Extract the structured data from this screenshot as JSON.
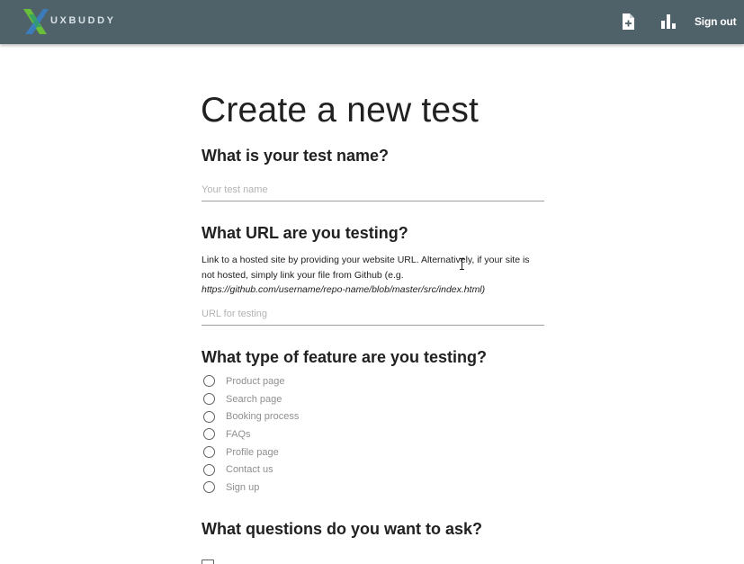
{
  "brand": {
    "name": "UXBUDDY",
    "colors": {
      "topbar": "#4f6169",
      "logo_green": "#6abf3a",
      "logo_blue": "#3a7fc4"
    }
  },
  "nav": {
    "new_test_icon": "file-plus-icon",
    "stats_icon": "bar-chart-icon",
    "signout_label": "Sign out"
  },
  "page": {
    "title": "Create a new test"
  },
  "test_name": {
    "heading": "What is your test name?",
    "placeholder": "Your test name",
    "value": ""
  },
  "url": {
    "heading": "What URL are you testing?",
    "description": "Link to a hosted site by providing your website URL. Alternatively, if your site is not hosted, simply link your file from Github (e.g.",
    "example_url": "https://github.com/username/repo-name/blob/master/src/index.html)",
    "placeholder": "URL for testing",
    "value": ""
  },
  "feature_type": {
    "heading": "What type of feature are you testing?",
    "options": [
      "Product page",
      "Search page",
      "Booking process",
      "FAQs",
      "Profile page",
      "Contact us",
      "Sign up"
    ]
  },
  "questions": {
    "heading": "What questions do you want to ask?"
  }
}
